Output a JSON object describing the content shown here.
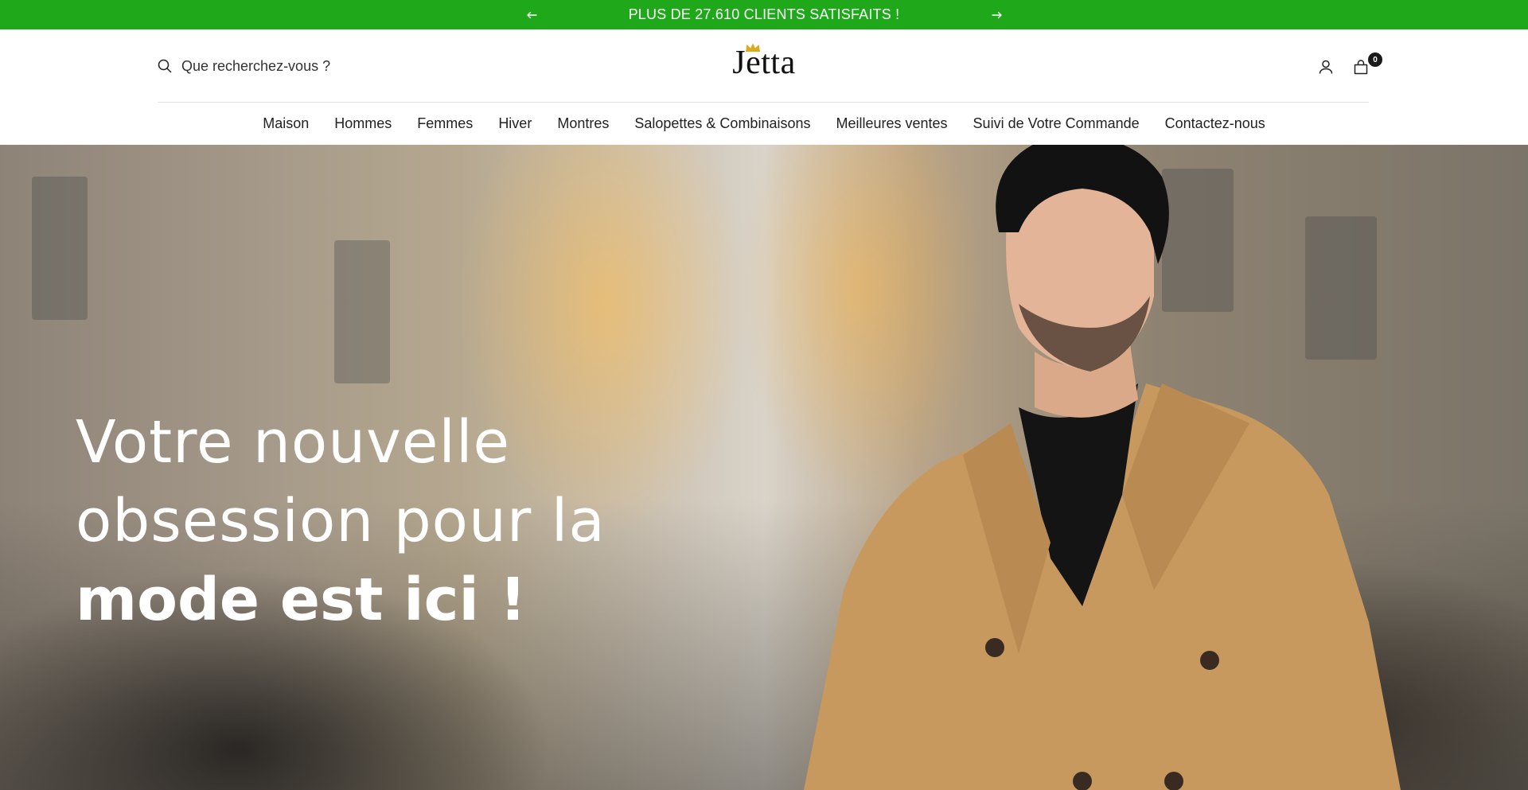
{
  "colors": {
    "announce_bg": "#1ea81a",
    "text": "#1a1a1a",
    "coat": "#c8995e"
  },
  "announcement": {
    "message": "PLUS DE 27.610 CLIENTS SATISFAITS !",
    "prev_icon": "arrow-left-icon",
    "next_icon": "arrow-right-icon"
  },
  "header": {
    "search": {
      "placeholder": "Que recherchez-vous ?",
      "icon": "search-icon"
    },
    "logo": {
      "text": "Jetta",
      "icon": "crown-icon"
    },
    "account_icon": "user-icon",
    "cart": {
      "icon": "shopping-bag-icon",
      "count": "0"
    }
  },
  "nav": {
    "items": [
      {
        "label": "Maison"
      },
      {
        "label": "Hommes"
      },
      {
        "label": "Femmes"
      },
      {
        "label": "Hiver"
      },
      {
        "label": "Montres"
      },
      {
        "label": "Salopettes & Combinaisons"
      },
      {
        "label": "Meilleures ventes"
      },
      {
        "label": "Suivi de Votre Commande"
      },
      {
        "label": "Contactez-nous"
      }
    ]
  },
  "hero": {
    "line1": "Votre nouvelle",
    "line2": "obsession pour la",
    "line3": "mode est ici !"
  }
}
